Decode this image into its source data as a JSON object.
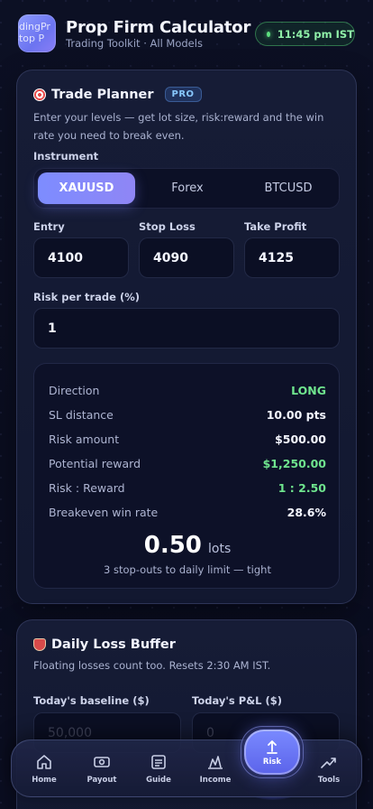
{
  "header": {
    "logo_line1": "ndingPr",
    "logo_line2": "Stop P",
    "title": "Prop Firm Calculator",
    "subtitle": "Trading Toolkit · All Models",
    "time": "11:45 pm IST"
  },
  "planner": {
    "title": "Trade Planner",
    "badge": "PRO",
    "description": "Enter your levels — get lot size, risk:reward and the win rate you need to break even.",
    "instrument_label": "Instrument",
    "instruments": [
      "XAUUSD",
      "Forex",
      "BTCUSD"
    ],
    "selected_instrument": "XAUUSD",
    "entry_label": "Entry",
    "entry_value": "4100",
    "stop_label": "Stop Loss",
    "stop_value": "4090",
    "tp_label": "Take Profit",
    "tp_value": "4125",
    "risk_label": "Risk per trade (%)",
    "risk_value": "1",
    "results": [
      {
        "label": "Direction",
        "value": "LONG"
      },
      {
        "label": "SL distance",
        "value": "10.00 pts"
      },
      {
        "label": "Risk amount",
        "value": "$500.00"
      },
      {
        "label": "Potential reward",
        "value": "$1,250.00"
      },
      {
        "label": "Risk : Reward",
        "value": "1 : 2.50"
      },
      {
        "label": "Breakeven win rate",
        "value": "28.6%"
      }
    ],
    "lots_value": "0.50",
    "lots_unit": "lots",
    "lots_note": "3 stop-outs to daily limit — tight"
  },
  "loss_buffer": {
    "title": "Daily Loss Buffer",
    "description": "Floating losses count too. Resets 2:30 AM IST.",
    "baseline_label": "Today's baseline ($)",
    "baseline_placeholder": "50,000",
    "pnl_label": "Today's P&L ($)",
    "pnl_placeholder": "0"
  },
  "nav": {
    "home": "Home",
    "payout": "Payout",
    "guide": "Guide",
    "income": "Income",
    "risk": "Risk",
    "tools": "Tools",
    "active": "Risk"
  },
  "colors": {
    "accent": "#7d8cff",
    "positive": "#6fe58e",
    "live_dot": "#5de07f"
  }
}
